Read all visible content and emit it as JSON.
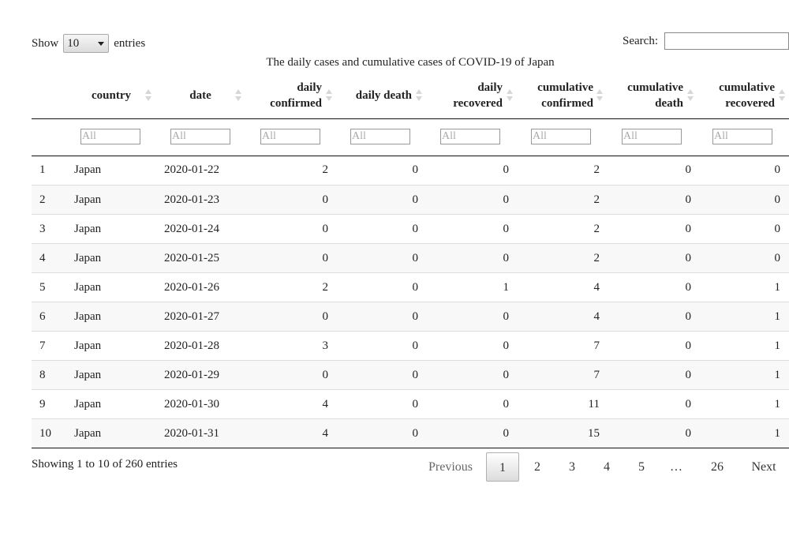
{
  "length": {
    "show_label": "Show",
    "value": "10",
    "entries_label": "entries"
  },
  "search": {
    "label": "Search:",
    "value": ""
  },
  "caption": "The daily cases and cumulative cases of COVID-19 of Japan",
  "columns": [
    {
      "line1": "country",
      "line2": ""
    },
    {
      "line1": "date",
      "line2": ""
    },
    {
      "line1": "daily",
      "line2": "confirmed"
    },
    {
      "line1": "daily death",
      "line2": ""
    },
    {
      "line1": "daily",
      "line2": "recovered"
    },
    {
      "line1": "cumulative",
      "line2": "confirmed"
    },
    {
      "line1": "cumulative",
      "line2": "death"
    },
    {
      "line1": "cumulative",
      "line2": "recovered"
    }
  ],
  "filter_placeholder": "All",
  "rows": [
    {
      "idx": "1",
      "country": "Japan",
      "date": "2020-01-22",
      "dc": "2",
      "dd": "0",
      "dr": "0",
      "cc": "2",
      "cd": "0",
      "cr": "0"
    },
    {
      "idx": "2",
      "country": "Japan",
      "date": "2020-01-23",
      "dc": "0",
      "dd": "0",
      "dr": "0",
      "cc": "2",
      "cd": "0",
      "cr": "0"
    },
    {
      "idx": "3",
      "country": "Japan",
      "date": "2020-01-24",
      "dc": "0",
      "dd": "0",
      "dr": "0",
      "cc": "2",
      "cd": "0",
      "cr": "0"
    },
    {
      "idx": "4",
      "country": "Japan",
      "date": "2020-01-25",
      "dc": "0",
      "dd": "0",
      "dr": "0",
      "cc": "2",
      "cd": "0",
      "cr": "0"
    },
    {
      "idx": "5",
      "country": "Japan",
      "date": "2020-01-26",
      "dc": "2",
      "dd": "0",
      "dr": "1",
      "cc": "4",
      "cd": "0",
      "cr": "1"
    },
    {
      "idx": "6",
      "country": "Japan",
      "date": "2020-01-27",
      "dc": "0",
      "dd": "0",
      "dr": "0",
      "cc": "4",
      "cd": "0",
      "cr": "1"
    },
    {
      "idx": "7",
      "country": "Japan",
      "date": "2020-01-28",
      "dc": "3",
      "dd": "0",
      "dr": "0",
      "cc": "7",
      "cd": "0",
      "cr": "1"
    },
    {
      "idx": "8",
      "country": "Japan",
      "date": "2020-01-29",
      "dc": "0",
      "dd": "0",
      "dr": "0",
      "cc": "7",
      "cd": "0",
      "cr": "1"
    },
    {
      "idx": "9",
      "country": "Japan",
      "date": "2020-01-30",
      "dc": "4",
      "dd": "0",
      "dr": "0",
      "cc": "11",
      "cd": "0",
      "cr": "1"
    },
    {
      "idx": "10",
      "country": "Japan",
      "date": "2020-01-31",
      "dc": "4",
      "dd": "0",
      "dr": "0",
      "cc": "15",
      "cd": "0",
      "cr": "1"
    }
  ],
  "info": "Showing 1 to 10 of 260 entries",
  "pagination": {
    "previous": "Previous",
    "pages": [
      "1",
      "2",
      "3",
      "4",
      "5",
      "…",
      "26"
    ],
    "current": "1",
    "next": "Next"
  },
  "sort_icon": "sort-both-icon"
}
